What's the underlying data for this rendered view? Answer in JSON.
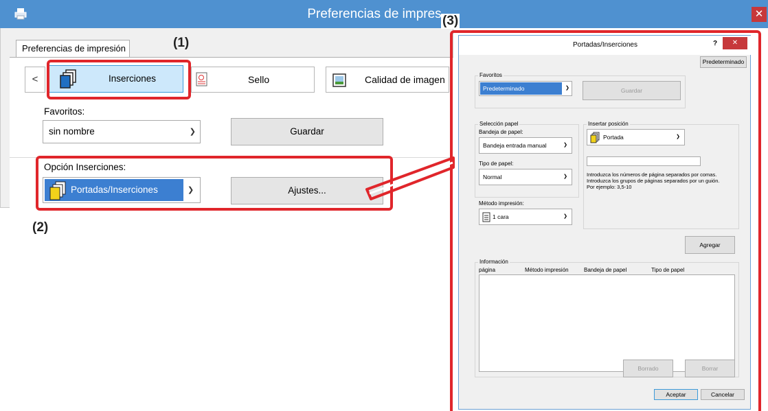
{
  "main_window": {
    "title": "Preferencias de impres",
    "close_glyph": "✕",
    "tab_label": "Preferencias de impresión",
    "nav_prev": "<",
    "toolbar": {
      "insertions_label": "Inserciones",
      "stamp_label": "Sello",
      "image_quality_label": "Calidad de imagen"
    },
    "favorites": {
      "label": "Favoritos:",
      "value": "sin nombre",
      "save_label": "Guardar"
    },
    "insert_option": {
      "label": "Opción Inserciones:",
      "value": "Portadas/Inserciones",
      "settings_label": "Ajustes..."
    }
  },
  "callouts": {
    "c1": "(1)",
    "c2": "(2)",
    "c3": "(3)"
  },
  "dialog": {
    "title": "Portadas/Inserciones",
    "help": "?",
    "close_glyph": "✕",
    "default_button": "Predeterminado",
    "favorites": {
      "group_label": "Favoritos",
      "value": "Predeterminado",
      "save_label": "Guardar"
    },
    "paper_selection": {
      "group_label": "Selección papel",
      "tray_label": "Bandeja de papel:",
      "tray_value": "Bandeja entrada manual",
      "type_label": "Tipo de papel:",
      "type_value": "Normal"
    },
    "print_method": {
      "label": "Método impresión:",
      "value": "1 cara"
    },
    "insert_position": {
      "group_label": "Insertar posición",
      "value": "Portada",
      "input_value": "",
      "help_line1": "Introduzca los números de página separados por comas.",
      "help_line2": "Introduzca los grupos de páginas separados por un guión.",
      "help_line3": "Por ejemplo:  3,5-10"
    },
    "add_button": "Agregar",
    "info": {
      "group_label": "Información",
      "columns": [
        "página",
        "Método impresión",
        "Bandeja de papel",
        "Tipo de papel"
      ]
    },
    "clear_button": "Borrado",
    "delete_button": "Borrar",
    "ok_button": "Aceptar",
    "cancel_button": "Cancelar"
  },
  "colors": {
    "titlebar": "#4f91d0",
    "highlight": "#e0262b",
    "selection": "#3c7fd1"
  }
}
